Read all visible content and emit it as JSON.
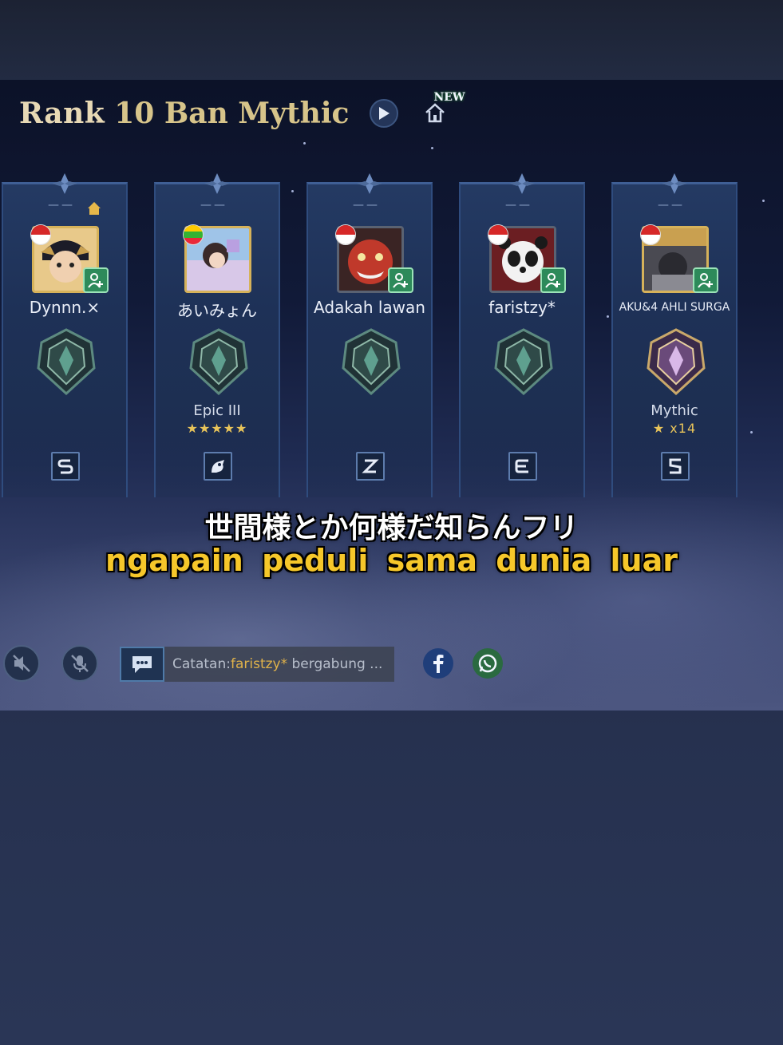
{
  "header": {
    "title_rank": "Rank",
    "title_mode": "10 Ban Mythic",
    "new_badge": "NEW"
  },
  "players": [
    {
      "dash": "——",
      "name": "Dynnn.×",
      "rank_label": "",
      "rank_stars": "",
      "flag": "ID",
      "role_icon": "S"
    },
    {
      "dash": "——",
      "name": "あいみょん",
      "rank_label": "Epic III",
      "rank_stars": "★★★★★",
      "flag": "MM",
      "role_icon": "beast"
    },
    {
      "dash": "——",
      "name": "Adakah lawan",
      "rank_label": "",
      "rank_stars": "",
      "flag": "ID",
      "role_icon": "Z"
    },
    {
      "dash": "——",
      "name": "faristzy*",
      "rank_label": "",
      "rank_stars": "",
      "flag": "ID",
      "role_icon": "E"
    },
    {
      "dash": "——",
      "name": "AKU&4 AHLI SURGA",
      "rank_label": "Mythic",
      "rank_stars": "★ x14",
      "flag": "ID",
      "role_icon": "S-box"
    }
  ],
  "subtitles": {
    "japanese": "世間様とか何様だ知らんフリ",
    "indonesian": "ngapain peduli sama dunia luar"
  },
  "chat": {
    "prefix": "Catatan:",
    "name": "faristzy*",
    "message": " bergabung ..."
  },
  "colors": {
    "title_gold": "#e8d9b5",
    "subtitle_yellow": "#f6c72a",
    "friend_green": "#2d8a5a"
  }
}
